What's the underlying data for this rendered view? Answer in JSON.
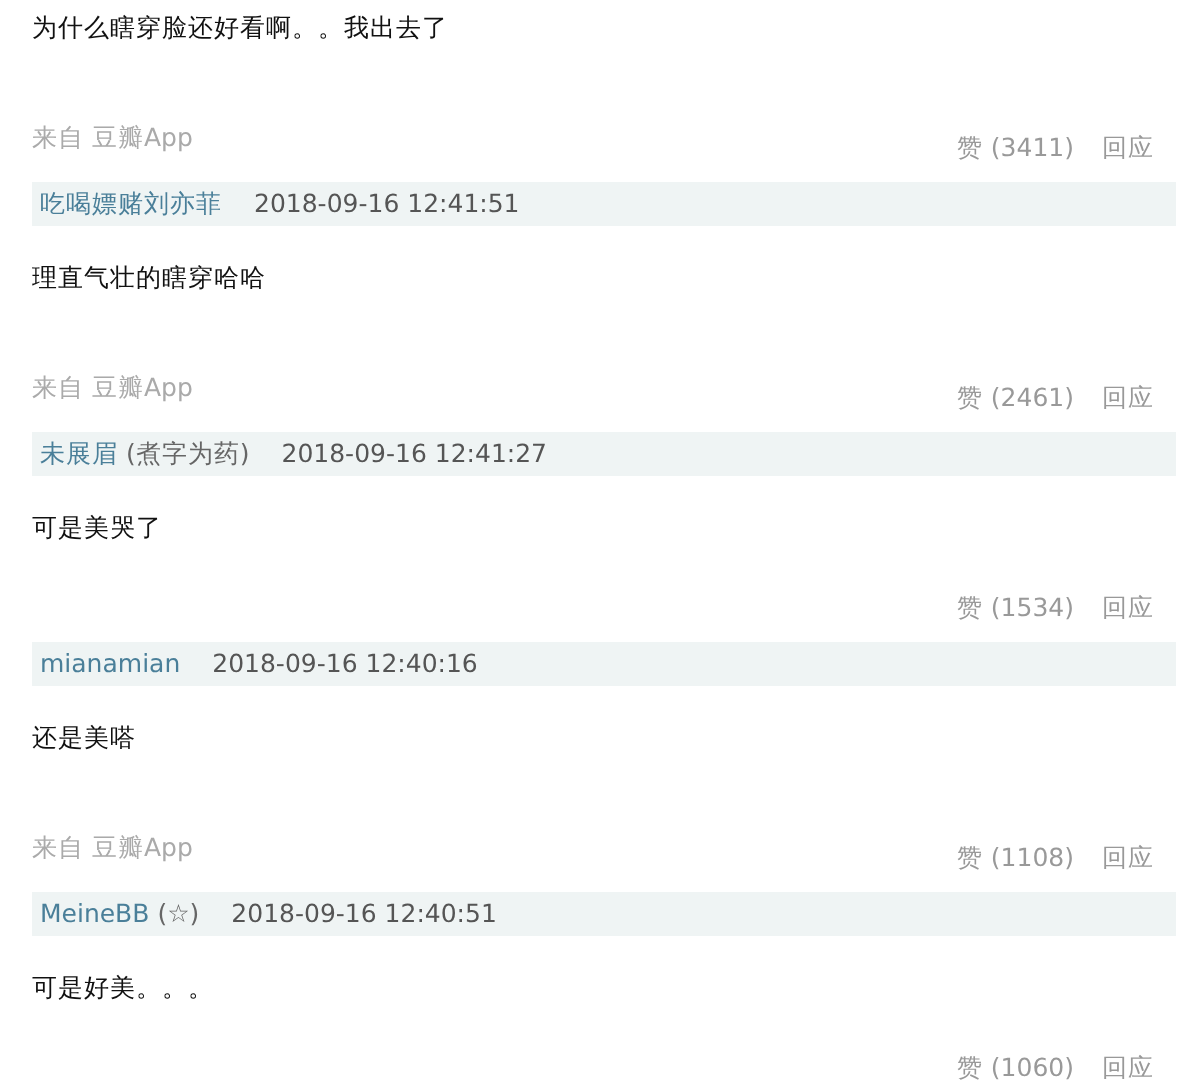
{
  "comments": [
    {
      "text": "为什么瞎穿脸还好看啊。。我出去了",
      "source": "来自 豆瓣App",
      "likes": "赞 (3411)",
      "reply": "回应"
    },
    {
      "author": "吃喝嫖赌刘亦菲",
      "time": "2018-09-16 12:41:51",
      "text": "理直气壮的瞎穿哈哈",
      "source": "来自 豆瓣App",
      "likes": "赞 (2461)",
      "reply": "回应"
    },
    {
      "author": "未展眉",
      "note": "(煮字为药)",
      "time": "2018-09-16 12:41:27",
      "text": "可是美哭了",
      "likes": "赞 (1534)",
      "reply": "回应"
    },
    {
      "author": "mianamian",
      "time": "2018-09-16 12:40:16",
      "text": "还是美嗒",
      "source": "来自 豆瓣App",
      "likes": "赞 (1108)",
      "reply": "回应"
    },
    {
      "author": "MeineBB",
      "note": "(☆)",
      "time": "2018-09-16 12:40:51",
      "text": "可是好美。。。",
      "likes": "赞 (1060)",
      "reply": "回应"
    }
  ]
}
